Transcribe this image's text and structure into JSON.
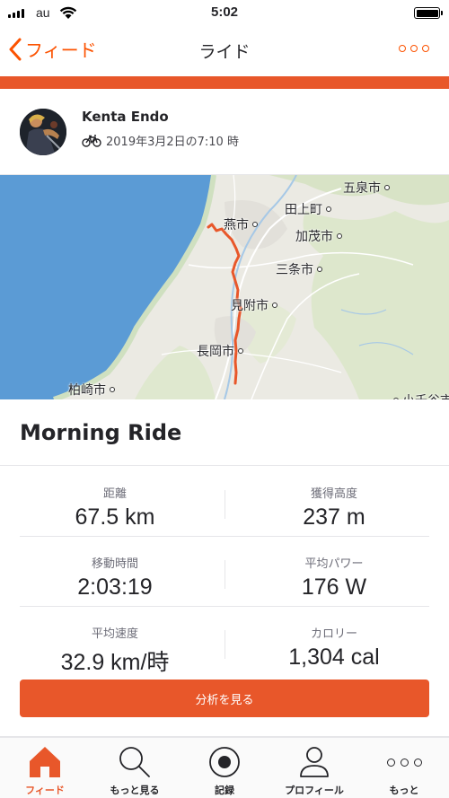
{
  "status_bar": {
    "carrier": "au",
    "time": "5:02"
  },
  "nav": {
    "back_label": "フィード",
    "title": "ライド"
  },
  "athlete": {
    "name": "Kenta Endo",
    "date": "2019年3月2日の7:10 時"
  },
  "map": {
    "cities": {
      "gosen": "五泉市",
      "tagami": "田上町",
      "tsubame": "燕市",
      "kamo": "加茂市",
      "sanjo": "三条市",
      "mitsuke": "見附市",
      "nagaoka": "長岡市",
      "kashiwazaki": "柏崎市",
      "ojiya": "小千谷市"
    },
    "route_color": "#e8572a",
    "sea_color": "#5b9bd5"
  },
  "activity": {
    "title": "Morning Ride"
  },
  "stats": [
    {
      "left": {
        "label": "距離",
        "value": "67.5 km"
      },
      "right": {
        "label": "獲得高度",
        "value": "237 m"
      }
    },
    {
      "left": {
        "label": "移動時間",
        "value": "2:03:19"
      },
      "right": {
        "label": "平均パワー",
        "value": "176 W"
      }
    },
    {
      "left": {
        "label": "平均速度",
        "value": "32.9 km/時"
      },
      "right": {
        "label": "カロリー",
        "value": "1,304 cal"
      }
    }
  ],
  "actions": {
    "analysis_label": "分析を見る"
  },
  "tabs": [
    {
      "label": "フィード",
      "icon": "home-icon",
      "active": true
    },
    {
      "label": "もっと見る",
      "icon": "search-icon",
      "active": false
    },
    {
      "label": "記録",
      "icon": "record-icon",
      "active": false
    },
    {
      "label": "プロフィール",
      "icon": "profile-icon",
      "active": false
    },
    {
      "label": "もっと",
      "icon": "more-icon",
      "active": false
    }
  ],
  "colors": {
    "accent": "#e8572a",
    "brand": "#fc5200"
  }
}
